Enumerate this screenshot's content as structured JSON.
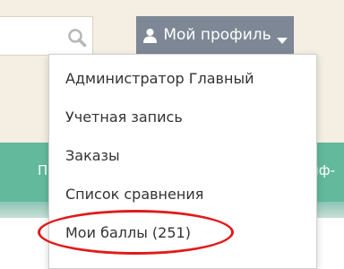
{
  "search": {
    "icon": "search-icon"
  },
  "header": {
    "profile_label": "Мой профиль",
    "profile_icon": "user-icon",
    "caret_icon": "caret-down-icon"
  },
  "nav": {
    "left_fragment": "П",
    "right_fragment": "йф-"
  },
  "dropdown": {
    "items": [
      {
        "label": "Администратор Главный"
      },
      {
        "label": "Учетная запись"
      },
      {
        "label": "Заказы"
      },
      {
        "label": "Список сравнения"
      },
      {
        "label": "Мои баллы (251)"
      }
    ]
  },
  "colors": {
    "page_bg": "#f4efe2",
    "profile_button": "#7e8795",
    "nav_bar": "#62b99c",
    "highlight": "#e01b1b"
  }
}
